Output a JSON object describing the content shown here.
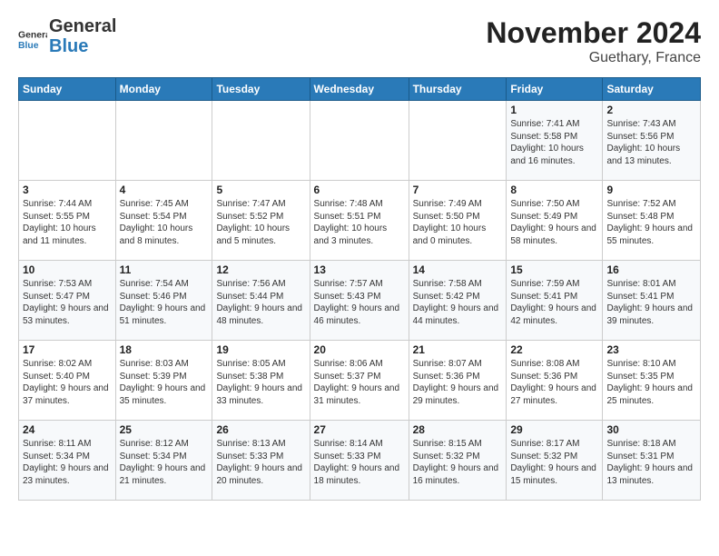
{
  "logo": {
    "general": "General",
    "blue": "Blue"
  },
  "title": "November 2024",
  "subtitle": "Guethary, France",
  "weekdays": [
    "Sunday",
    "Monday",
    "Tuesday",
    "Wednesday",
    "Thursday",
    "Friday",
    "Saturday"
  ],
  "weeks": [
    [
      {
        "day": "",
        "info": ""
      },
      {
        "day": "",
        "info": ""
      },
      {
        "day": "",
        "info": ""
      },
      {
        "day": "",
        "info": ""
      },
      {
        "day": "",
        "info": ""
      },
      {
        "day": "1",
        "info": "Sunrise: 7:41 AM\nSunset: 5:58 PM\nDaylight: 10 hours and 16 minutes."
      },
      {
        "day": "2",
        "info": "Sunrise: 7:43 AM\nSunset: 5:56 PM\nDaylight: 10 hours and 13 minutes."
      }
    ],
    [
      {
        "day": "3",
        "info": "Sunrise: 7:44 AM\nSunset: 5:55 PM\nDaylight: 10 hours and 11 minutes."
      },
      {
        "day": "4",
        "info": "Sunrise: 7:45 AM\nSunset: 5:54 PM\nDaylight: 10 hours and 8 minutes."
      },
      {
        "day": "5",
        "info": "Sunrise: 7:47 AM\nSunset: 5:52 PM\nDaylight: 10 hours and 5 minutes."
      },
      {
        "day": "6",
        "info": "Sunrise: 7:48 AM\nSunset: 5:51 PM\nDaylight: 10 hours and 3 minutes."
      },
      {
        "day": "7",
        "info": "Sunrise: 7:49 AM\nSunset: 5:50 PM\nDaylight: 10 hours and 0 minutes."
      },
      {
        "day": "8",
        "info": "Sunrise: 7:50 AM\nSunset: 5:49 PM\nDaylight: 9 hours and 58 minutes."
      },
      {
        "day": "9",
        "info": "Sunrise: 7:52 AM\nSunset: 5:48 PM\nDaylight: 9 hours and 55 minutes."
      }
    ],
    [
      {
        "day": "10",
        "info": "Sunrise: 7:53 AM\nSunset: 5:47 PM\nDaylight: 9 hours and 53 minutes."
      },
      {
        "day": "11",
        "info": "Sunrise: 7:54 AM\nSunset: 5:46 PM\nDaylight: 9 hours and 51 minutes."
      },
      {
        "day": "12",
        "info": "Sunrise: 7:56 AM\nSunset: 5:44 PM\nDaylight: 9 hours and 48 minutes."
      },
      {
        "day": "13",
        "info": "Sunrise: 7:57 AM\nSunset: 5:43 PM\nDaylight: 9 hours and 46 minutes."
      },
      {
        "day": "14",
        "info": "Sunrise: 7:58 AM\nSunset: 5:42 PM\nDaylight: 9 hours and 44 minutes."
      },
      {
        "day": "15",
        "info": "Sunrise: 7:59 AM\nSunset: 5:41 PM\nDaylight: 9 hours and 42 minutes."
      },
      {
        "day": "16",
        "info": "Sunrise: 8:01 AM\nSunset: 5:41 PM\nDaylight: 9 hours and 39 minutes."
      }
    ],
    [
      {
        "day": "17",
        "info": "Sunrise: 8:02 AM\nSunset: 5:40 PM\nDaylight: 9 hours and 37 minutes."
      },
      {
        "day": "18",
        "info": "Sunrise: 8:03 AM\nSunset: 5:39 PM\nDaylight: 9 hours and 35 minutes."
      },
      {
        "day": "19",
        "info": "Sunrise: 8:05 AM\nSunset: 5:38 PM\nDaylight: 9 hours and 33 minutes."
      },
      {
        "day": "20",
        "info": "Sunrise: 8:06 AM\nSunset: 5:37 PM\nDaylight: 9 hours and 31 minutes."
      },
      {
        "day": "21",
        "info": "Sunrise: 8:07 AM\nSunset: 5:36 PM\nDaylight: 9 hours and 29 minutes."
      },
      {
        "day": "22",
        "info": "Sunrise: 8:08 AM\nSunset: 5:36 PM\nDaylight: 9 hours and 27 minutes."
      },
      {
        "day": "23",
        "info": "Sunrise: 8:10 AM\nSunset: 5:35 PM\nDaylight: 9 hours and 25 minutes."
      }
    ],
    [
      {
        "day": "24",
        "info": "Sunrise: 8:11 AM\nSunset: 5:34 PM\nDaylight: 9 hours and 23 minutes."
      },
      {
        "day": "25",
        "info": "Sunrise: 8:12 AM\nSunset: 5:34 PM\nDaylight: 9 hours and 21 minutes."
      },
      {
        "day": "26",
        "info": "Sunrise: 8:13 AM\nSunset: 5:33 PM\nDaylight: 9 hours and 20 minutes."
      },
      {
        "day": "27",
        "info": "Sunrise: 8:14 AM\nSunset: 5:33 PM\nDaylight: 9 hours and 18 minutes."
      },
      {
        "day": "28",
        "info": "Sunrise: 8:15 AM\nSunset: 5:32 PM\nDaylight: 9 hours and 16 minutes."
      },
      {
        "day": "29",
        "info": "Sunrise: 8:17 AM\nSunset: 5:32 PM\nDaylight: 9 hours and 15 minutes."
      },
      {
        "day": "30",
        "info": "Sunrise: 8:18 AM\nSunset: 5:31 PM\nDaylight: 9 hours and 13 minutes."
      }
    ]
  ]
}
